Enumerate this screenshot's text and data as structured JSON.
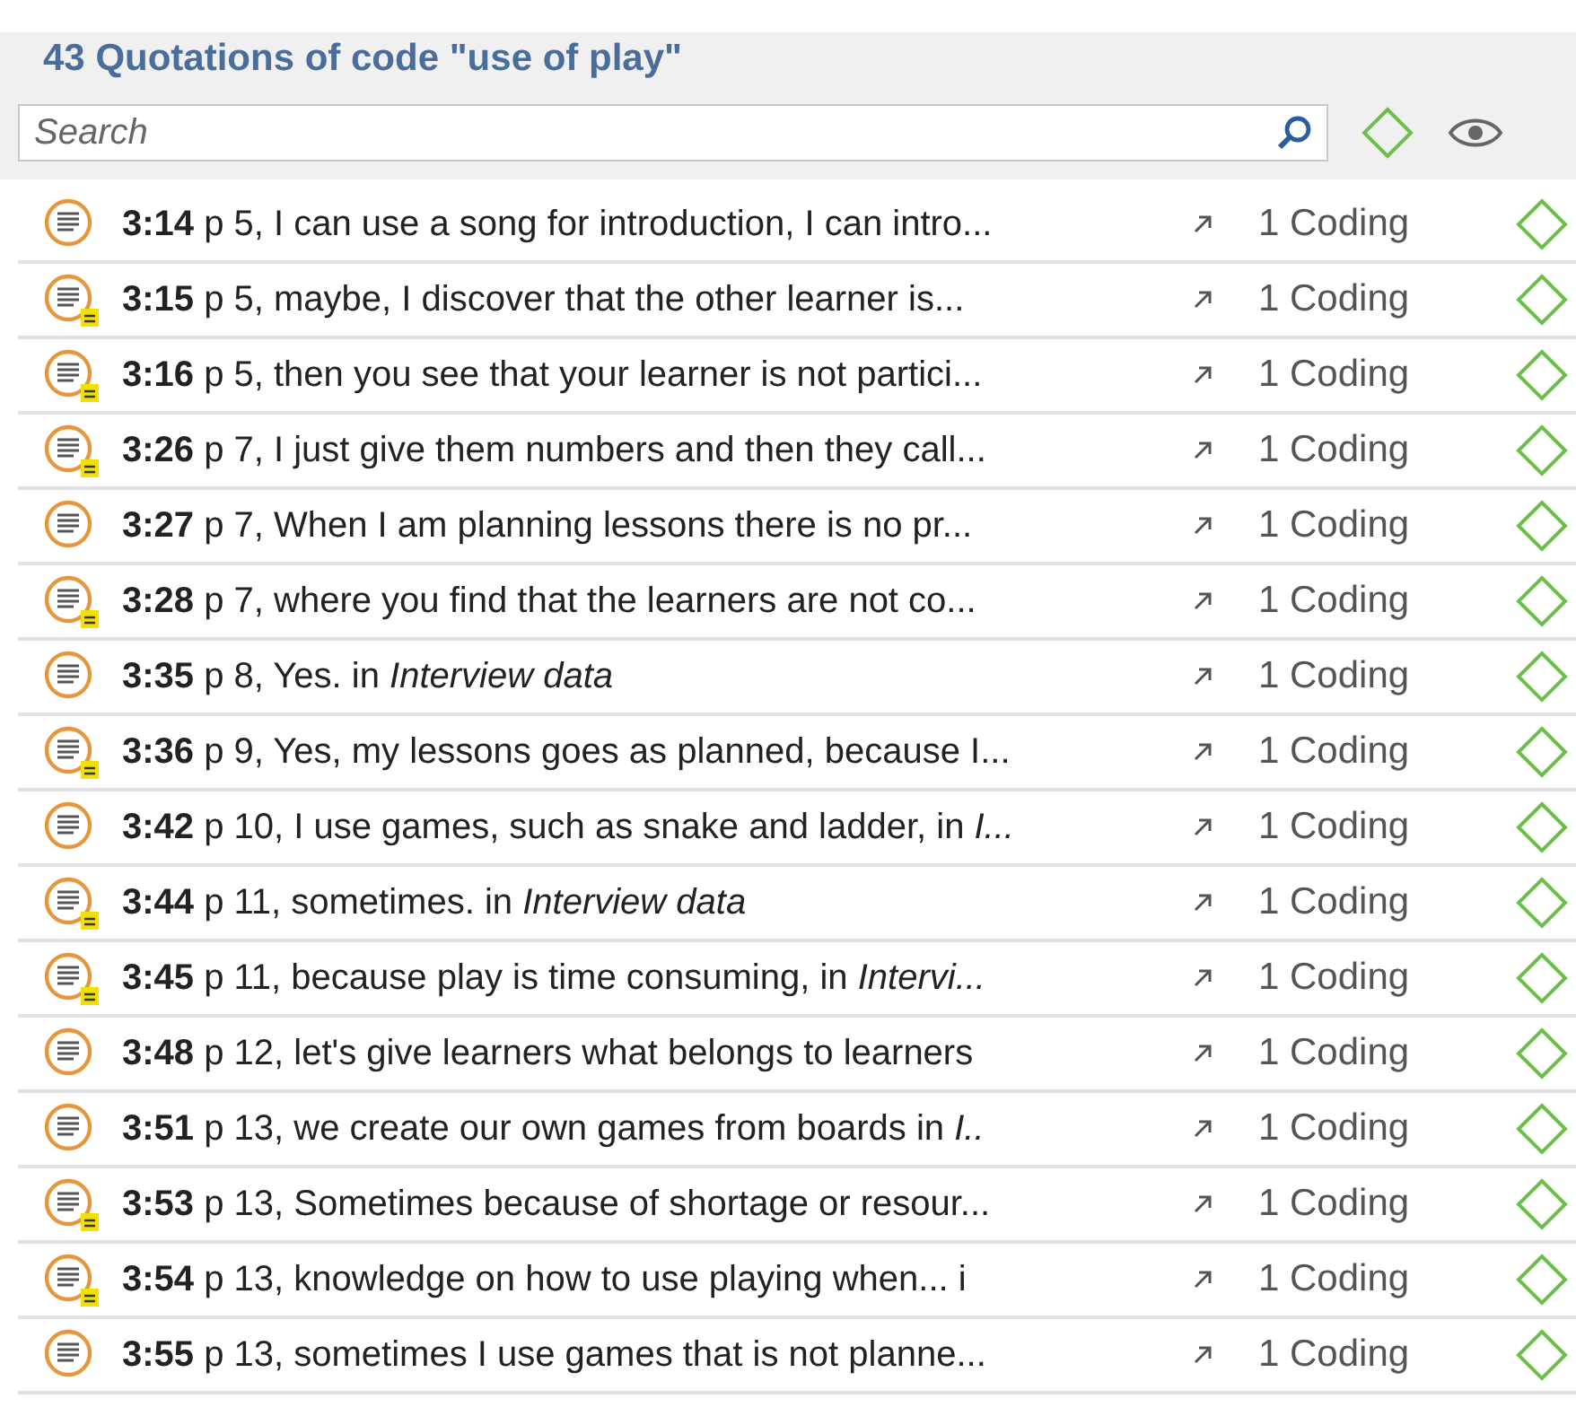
{
  "title": "43 Quotations of code \"use of play\"",
  "search": {
    "placeholder": "Search"
  },
  "quotations": [
    {
      "text": "**3:14** p 5, I can use a song for introduction, I can intro...",
      "has_comment": false,
      "codings": "1 Coding"
    },
    {
      "text": "**3:15** p 5, maybe, I  discover that the other learner is...",
      "has_comment": true,
      "codings": "1 Coding"
    },
    {
      "text": "**3:16** p 5, then you  see that your learner is not partici...",
      "has_comment": true,
      "codings": "1 Coding"
    },
    {
      "text": "**3:26** p 7, I just give them numbers and then they call...",
      "has_comment": true,
      "codings": "1 Coding"
    },
    {
      "text": "**3:27** p 7, When I am planning lessons there is no pr...",
      "has_comment": false,
      "codings": "1 Coding"
    },
    {
      "text": "**3:28** p 7, where you find that the learners are not co...",
      "has_comment": true,
      "codings": "1 Coding"
    },
    {
      "text": "**3:35** p 8, Yes. in *Interview data*",
      "has_comment": false,
      "codings": "1 Coding"
    },
    {
      "text": "**3:36** p 9, Yes, my lessons goes as planned, because I...",
      "has_comment": true,
      "codings": "1 Coding"
    },
    {
      "text": "**3:42** p 10, I use games, such as snake and ladder, in *I...*",
      "has_comment": false,
      "codings": "1 Coding"
    },
    {
      "text": "**3:44** p 11, sometimes. in *Interview data*",
      "has_comment": true,
      "codings": "1 Coding"
    },
    {
      "text": "**3:45** p 11, because play is time consuming, in *Intervi...*",
      "has_comment": true,
      "codings": "1 Coding"
    },
    {
      "text": "**3:48** p 12, let's give learners what belongs to learners",
      "has_comment": false,
      "codings": "1 Coding"
    },
    {
      "text": "**3:51** p 13, we create  our own games from boards in *I..*",
      "has_comment": false,
      "codings": "1 Coding"
    },
    {
      "text": "**3:53** p 13, Sometimes because of shortage or resour...",
      "has_comment": true,
      "codings": "1 Coding"
    },
    {
      "text": "**3:54** p 13, knowledge on how to  use playing when... i",
      "has_comment": true,
      "codings": "1 Coding"
    },
    {
      "text": "**3:55** p 13, sometimes I use games that is not planne...",
      "has_comment": false,
      "codings": "1 Coding"
    }
  ]
}
